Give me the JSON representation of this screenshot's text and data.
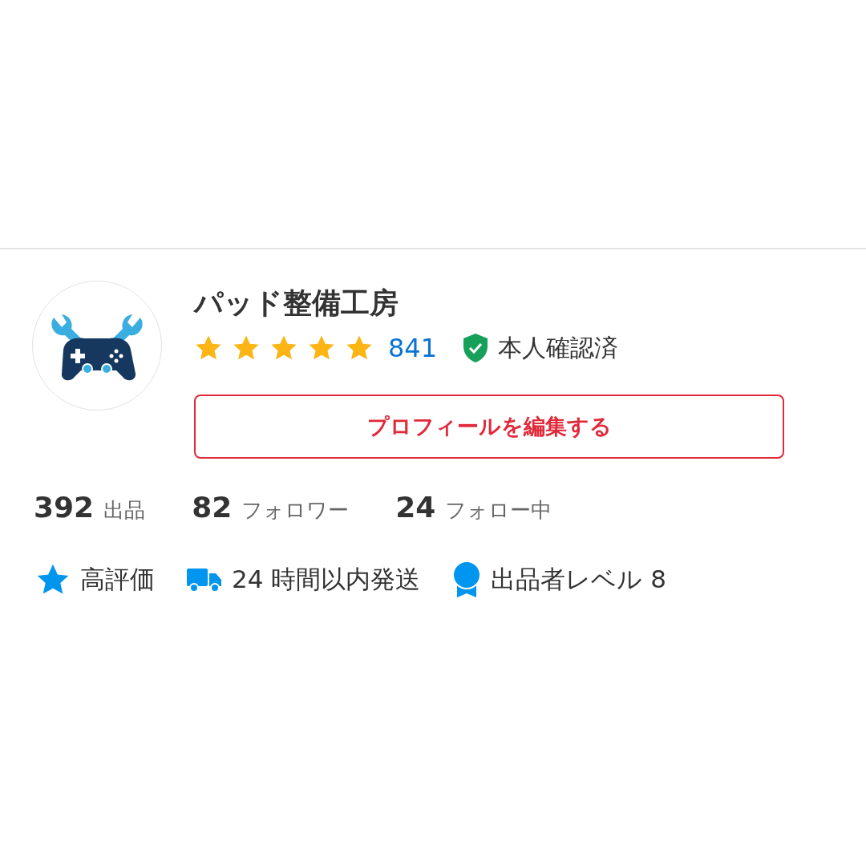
{
  "profile": {
    "name": "パッド整備工房",
    "stars": 5,
    "review_count": "841",
    "verification": "本人確認済",
    "edit_button": "プロフィールを編集する"
  },
  "stats": [
    {
      "value": "392",
      "label": "出品"
    },
    {
      "value": "82",
      "label": "フォロワー"
    },
    {
      "value": "24",
      "label": "フォロー中"
    }
  ],
  "badges": [
    {
      "kind": "star",
      "label": "高評価"
    },
    {
      "kind": "truck",
      "label": "24 時間以内発送"
    },
    {
      "kind": "medal",
      "label": "出品者レベル 8"
    }
  ]
}
